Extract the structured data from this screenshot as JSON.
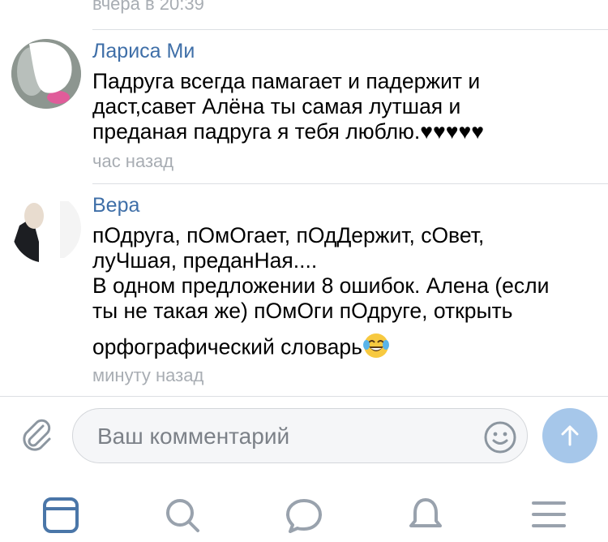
{
  "top_timestamp": "вчера в 20:39",
  "comments": [
    {
      "author": "Лариса Ми",
      "text_lines": [
        "Падруга всегда памагает и падержит и",
        "даст,савет Алёна ты самая лутшая и",
        "преданая падруга я тебя люблю.♥♥♥♥♥"
      ],
      "time": "час назад"
    },
    {
      "author": "Вера",
      "text_lines": [
        "пОдруга, пОмОгает, пОдДержит, сОвет,",
        "луЧшая, преданНая....",
        "В одном предложении 8 ошибок. Алена (если",
        "ты не такая же) пОмОги пОдруге, открыть",
        "орфографический словарь"
      ],
      "text_emoji": "face-with-tears-of-joy-emoji",
      "time": "минуту назад"
    }
  ],
  "composer": {
    "placeholder": "Ваш комментарий",
    "attach_icon": "paperclip-icon",
    "emoji_icon": "smiley-icon",
    "send_icon": "arrow-up-icon",
    "send_color": "#a6c7ea"
  },
  "tabbar": {
    "items": [
      "news-icon",
      "search-icon",
      "messages-icon",
      "notifications-icon",
      "menu-icon"
    ],
    "active": "news-icon",
    "active_color": "#4a76a8",
    "inactive_color": "#99a2ad"
  },
  "colors": {
    "author": "#3f6fa8",
    "secondary_text": "#a8adb3",
    "divider": "#dcdfe3"
  }
}
